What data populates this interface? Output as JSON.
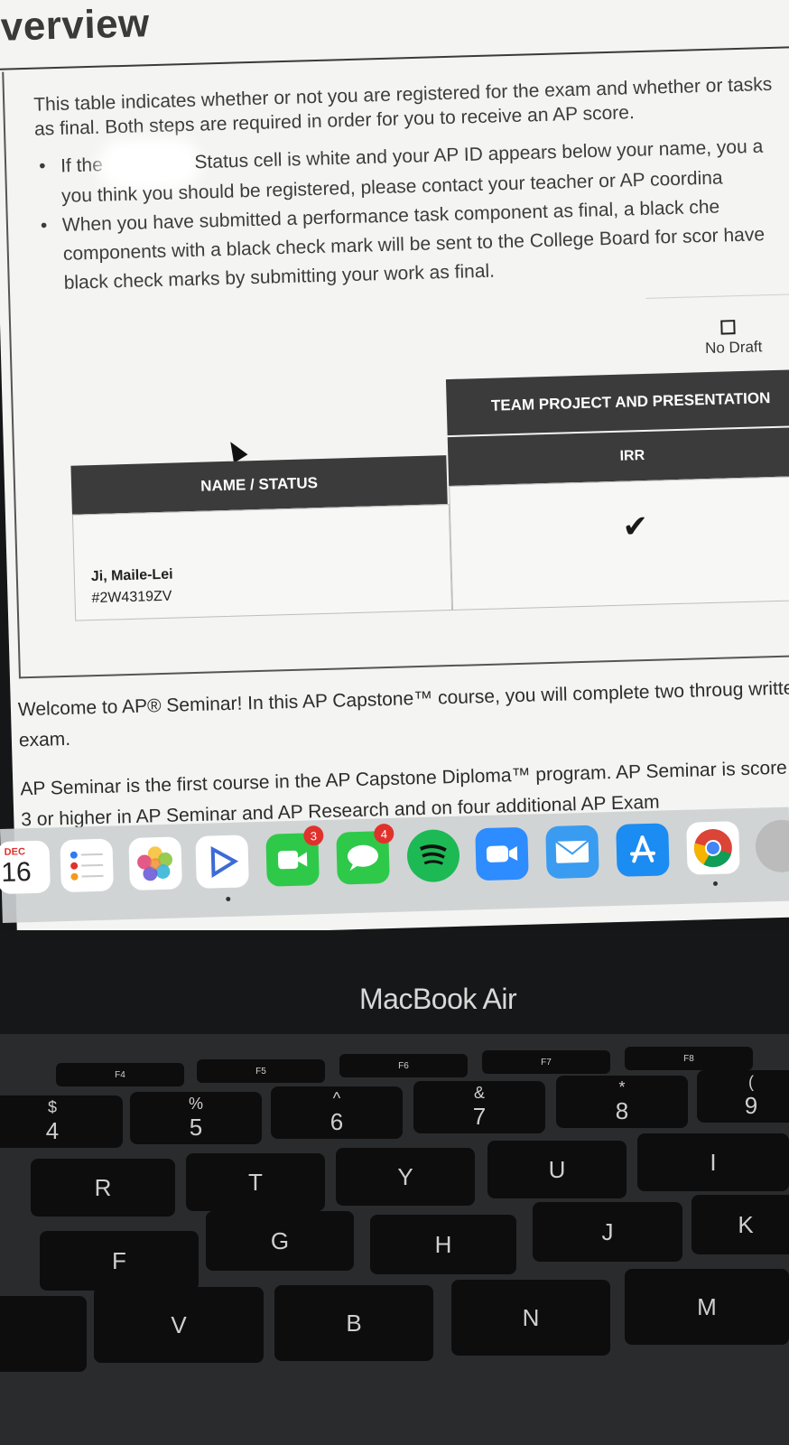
{
  "page": {
    "heading": "verview",
    "intro": "This table indicates whether or not you are registered for the exam and whether or tasks as final. Both steps are required in order for you to receive an AP score.",
    "bullets": [
      {
        "pre": "If the",
        "post": "Status cell is white and your AP ID appears below your name, you a you think you should be registered, please contact your teacher or AP coordina"
      },
      {
        "text": "When you have submitted a performance task component as final, a black che components with a black check mark will be sent to the College Board for scor have black check marks by submitting your work as final."
      }
    ],
    "no_draft_label": "No Draft",
    "table": {
      "group_header": "TEAM PROJECT AND PRESENTATION",
      "sub_header": "IRR",
      "name_header": "NAME / STATUS",
      "student_name": "Ji, Maile-Lei",
      "student_id": "#2W4319ZV",
      "irr_status": "✔"
    },
    "welcome": "Welcome to AP® Seminar! In this AP Capstone™ course, you will complete two throug written exam.",
    "ap_seminar": "AP Seminar is the first course in the AP Capstone Diploma™ program.  AP Seminar is score of 3 or higher in AP Seminar and AP Research and on four additional AP Exam"
  },
  "dock": {
    "calendar_month": "DEC",
    "calendar_day": "16",
    "facetime_badge": "3",
    "messages_badge": "4",
    "apps": [
      "calendar-icon",
      "reminders-icon",
      "photos-icon",
      "play-icon",
      "facetime-icon",
      "messages-icon",
      "spotify-icon",
      "zoom-icon",
      "mail-icon",
      "app-store-icon",
      "chrome-icon"
    ]
  },
  "laptop": {
    "brand": "MacBook Air",
    "keys": {
      "f4": "F4",
      "f5": "F5",
      "f6": "F6",
      "f7": "F7",
      "f8": "F8",
      "k4_top": "$",
      "k4": "4",
      "k5_top": "%",
      "k5": "5",
      "k6_top": "^",
      "k6": "6",
      "k7_top": "&",
      "k7": "7",
      "k8_top": "*",
      "k8": "8",
      "k9_top": "(",
      "k9": "9",
      "r": "R",
      "t": "T",
      "y": "Y",
      "u": "U",
      "i": "I",
      "f": "F",
      "g": "G",
      "h": "H",
      "j": "J",
      "k": "K",
      "v": "V",
      "b": "B",
      "n": "N",
      "m": "M"
    }
  }
}
